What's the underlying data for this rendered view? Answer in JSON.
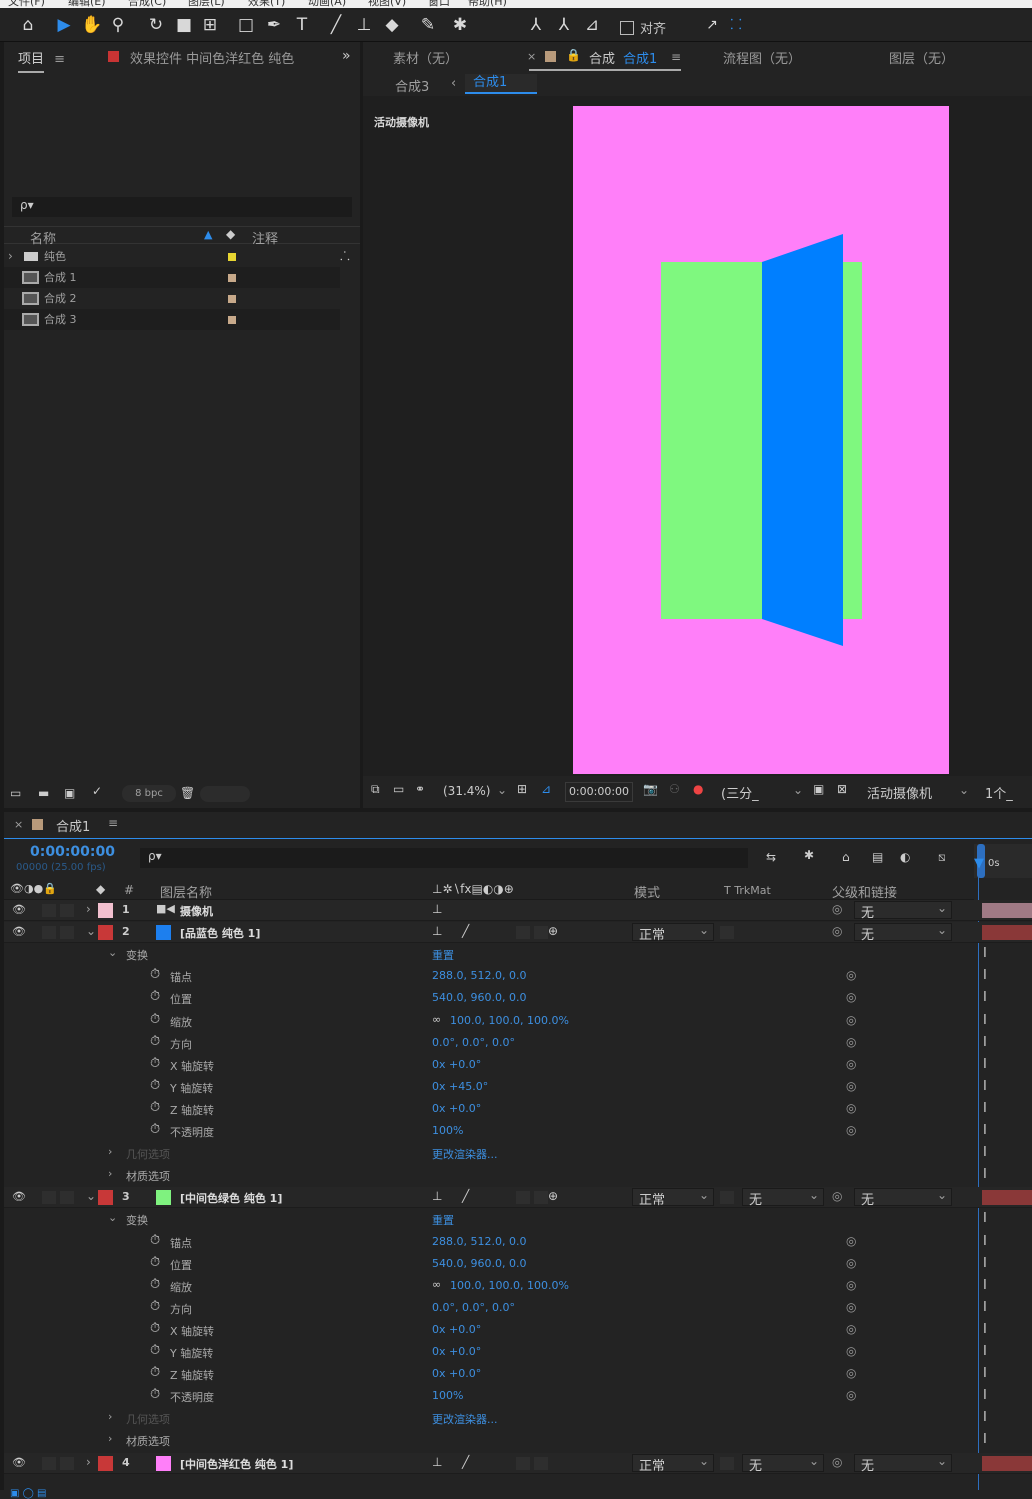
{
  "menu": [
    "文件(F)",
    "编辑(E)",
    "合成(C)",
    "图层(L)",
    "效果(T)",
    "动画(A)",
    "视图(V)",
    "窗口",
    "帮助(H)"
  ],
  "toolbar": {
    "align_label": "对齐"
  },
  "project_panel": {
    "tab_label": "项目",
    "effects_tab": "效果控件 中间色洋红色 纯色",
    "search_placeholder": "ρ▾",
    "col_name": "名称",
    "col_comment": "注释",
    "items": [
      {
        "name": "纯色",
        "type": "folder",
        "color": "#e7d531"
      },
      {
        "name": "合成 1",
        "type": "comp",
        "color": "#c7a98a"
      },
      {
        "name": "合成 2",
        "type": "comp",
        "color": "#c7a98a"
      },
      {
        "name": "合成 3",
        "type": "comp",
        "color": "#c7a98a"
      }
    ],
    "bpc": "8 bpc"
  },
  "viewer": {
    "tabs": [
      "素材（无）",
      "合成",
      "合成1",
      "流程图（无）",
      "图层（无）"
    ],
    "breadcrumb_parent": "合成3",
    "breadcrumb_current": "合成1",
    "camera_label": "活动摄像机",
    "zoom": "(31.4%)",
    "timecode": "0:00:00:00",
    "resolution": "(三分_",
    "camera_select": "活动摄像机",
    "views": "1个_",
    "bg_color": "#ff7ff9",
    "green_color": "#7ff87f",
    "blue_color": "#007fff"
  },
  "timeline": {
    "tab": "合成1",
    "timecode": "0:00:00:00",
    "frame_info": "00000 (25.00 fps)",
    "ruler_label": "0s",
    "headers": {
      "num": "#",
      "name": "图层名称",
      "mode": "模式",
      "trkmat": "T  TrkMat",
      "parent": "父级和链接"
    },
    "layers": [
      {
        "num": "1",
        "name": "摄像机",
        "color": "#f2c0cf",
        "mode": "",
        "trkmat": "",
        "parent": "无"
      },
      {
        "num": "2",
        "name": "[品蓝色 纯色 1]",
        "color": "#c83838",
        "swatch": "#1d7fee",
        "mode": "正常",
        "trkmat": "",
        "parent": "无"
      },
      {
        "num": "3",
        "name": "[中间色绿色 纯色 1]",
        "color": "#c83838",
        "swatch": "#7ff27f",
        "mode": "正常",
        "trkmat": "无",
        "parent": "无"
      },
      {
        "num": "4",
        "name": "[中间色洋红色 纯色 1]",
        "color": "#c83838",
        "swatch": "#ff7ff9",
        "mode": "正常",
        "trkmat": "无",
        "parent": "无"
      }
    ],
    "transform_label": "变换",
    "reset_label": "重置",
    "geometry_label": "几何选项",
    "material_label": "材质选项",
    "renderer_label": "更改渲染器...",
    "props_names": [
      "锚点",
      "位置",
      "缩放",
      "方向",
      "X 轴旋转",
      "Y 轴旋转",
      "Z 轴旋转",
      "不透明度"
    ],
    "layer2_values": [
      "288.0, 512.0, 0.0",
      "540.0, 960.0, 0.0",
      "100.0, 100.0, 100.0%",
      "0.0°, 0.0°, 0.0°",
      "0x +0.0°",
      "0x +45.0°",
      "0x +0.0°",
      "100%"
    ],
    "layer3_values": [
      "288.0, 512.0, 0.0",
      "540.0, 960.0, 0.0",
      "100.0, 100.0, 100.0%",
      "0.0°, 0.0°, 0.0°",
      "0x +0.0°",
      "0x +0.0°",
      "0x +0.0°",
      "100%"
    ]
  }
}
